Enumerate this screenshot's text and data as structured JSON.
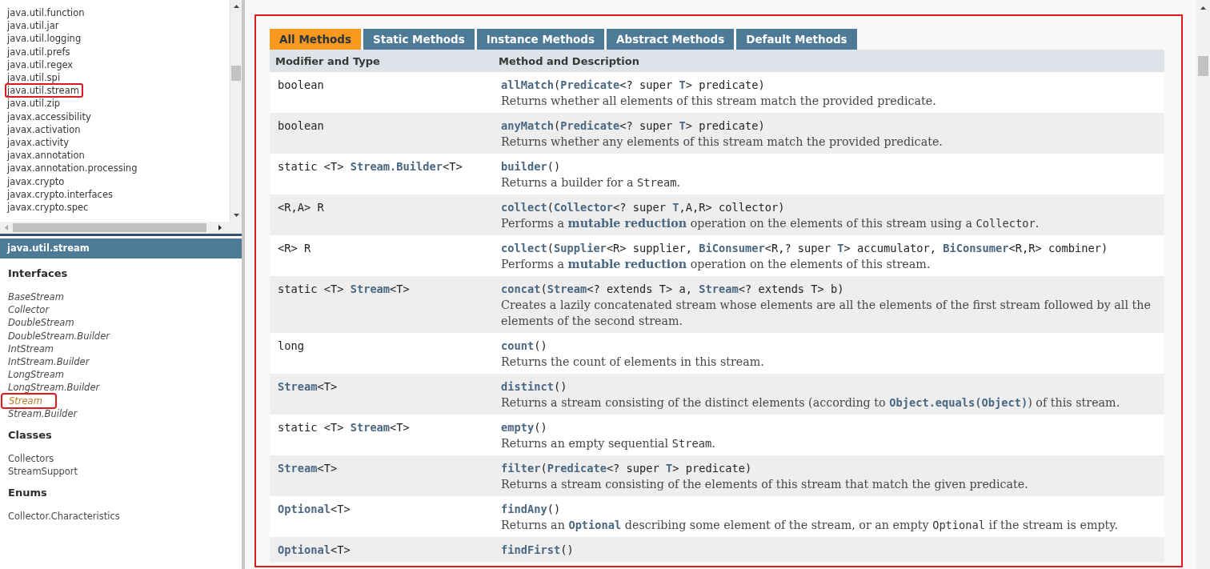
{
  "package_list": {
    "items": [
      {
        "label": "java.util.function",
        "highlighted": false
      },
      {
        "label": "java.util.jar",
        "highlighted": false
      },
      {
        "label": "java.util.logging",
        "highlighted": false
      },
      {
        "label": "java.util.prefs",
        "highlighted": false
      },
      {
        "label": "java.util.regex",
        "highlighted": false
      },
      {
        "label": "java.util.spi",
        "highlighted": false
      },
      {
        "label": "java.util.stream",
        "highlighted": true
      },
      {
        "label": "java.util.zip",
        "highlighted": false
      },
      {
        "label": "javax.accessibility",
        "highlighted": false
      },
      {
        "label": "javax.activation",
        "highlighted": false
      },
      {
        "label": "javax.activity",
        "highlighted": false
      },
      {
        "label": "javax.annotation",
        "highlighted": false
      },
      {
        "label": "javax.annotation.processing",
        "highlighted": false
      },
      {
        "label": "javax.crypto",
        "highlighted": false
      },
      {
        "label": "javax.crypto.interfaces",
        "highlighted": false
      },
      {
        "label": "javax.crypto.spec",
        "highlighted": false
      }
    ]
  },
  "package_frame": {
    "title": "java.util.stream",
    "sections": [
      {
        "heading": "Interfaces",
        "kind": "interface",
        "items": [
          {
            "label": "BaseStream",
            "current": false,
            "highlighted": false
          },
          {
            "label": "Collector",
            "current": false,
            "highlighted": false
          },
          {
            "label": "DoubleStream",
            "current": false,
            "highlighted": false
          },
          {
            "label": "DoubleStream.Builder",
            "current": false,
            "highlighted": false
          },
          {
            "label": "IntStream",
            "current": false,
            "highlighted": false
          },
          {
            "label": "IntStream.Builder",
            "current": false,
            "highlighted": false
          },
          {
            "label": "LongStream",
            "current": false,
            "highlighted": false
          },
          {
            "label": "LongStream.Builder",
            "current": false,
            "highlighted": false
          },
          {
            "label": "Stream",
            "current": true,
            "highlighted": true
          },
          {
            "label": "Stream.Builder",
            "current": false,
            "highlighted": false
          }
        ]
      },
      {
        "heading": "Classes",
        "kind": "class",
        "items": [
          {
            "label": "Collectors",
            "current": false,
            "highlighted": false
          },
          {
            "label": "StreamSupport",
            "current": false,
            "highlighted": false
          }
        ]
      },
      {
        "heading": "Enums",
        "kind": "class",
        "items": [
          {
            "label": "Collector.Characteristics",
            "current": false,
            "highlighted": false
          }
        ]
      }
    ]
  },
  "content": {
    "highlighted": true,
    "tabs": [
      {
        "label": "All Methods",
        "selected": true
      },
      {
        "label": "Static Methods",
        "selected": false
      },
      {
        "label": "Instance Methods",
        "selected": false
      },
      {
        "label": "Abstract Methods",
        "selected": false
      },
      {
        "label": "Default Methods",
        "selected": false
      }
    ],
    "columns": [
      "Modifier and Type",
      "Method and Description"
    ],
    "rows": [
      {
        "modifier": [
          {
            "text": "boolean",
            "kind": "plain"
          }
        ],
        "signature": [
          {
            "text": "allMatch",
            "kind": "link"
          },
          {
            "text": "(",
            "kind": "plain"
          },
          {
            "text": "Predicate",
            "kind": "link"
          },
          {
            "text": "<? super ",
            "kind": "plain"
          },
          {
            "text": "T",
            "kind": "link"
          },
          {
            "text": "> predicate)",
            "kind": "plain"
          }
        ],
        "description": [
          {
            "text": "Returns whether all elements of this stream match the provided predicate.",
            "kind": "plain"
          }
        ]
      },
      {
        "modifier": [
          {
            "text": "boolean",
            "kind": "plain"
          }
        ],
        "signature": [
          {
            "text": "anyMatch",
            "kind": "link"
          },
          {
            "text": "(",
            "kind": "plain"
          },
          {
            "text": "Predicate",
            "kind": "link"
          },
          {
            "text": "<? super ",
            "kind": "plain"
          },
          {
            "text": "T",
            "kind": "link"
          },
          {
            "text": "> predicate)",
            "kind": "plain"
          }
        ],
        "description": [
          {
            "text": "Returns whether any elements of this stream match the provided predicate.",
            "kind": "plain"
          }
        ]
      },
      {
        "modifier": [
          {
            "text": "static <T> ",
            "kind": "plain"
          },
          {
            "text": "Stream.Builder",
            "kind": "link"
          },
          {
            "text": "<T>",
            "kind": "plain"
          }
        ],
        "signature": [
          {
            "text": "builder",
            "kind": "link"
          },
          {
            "text": "()",
            "kind": "plain"
          }
        ],
        "description": [
          {
            "text": "Returns a builder for a ",
            "kind": "plain"
          },
          {
            "text": "Stream",
            "kind": "code"
          },
          {
            "text": ".",
            "kind": "plain"
          }
        ]
      },
      {
        "modifier": [
          {
            "text": "<R,A> R",
            "kind": "plain"
          }
        ],
        "signature": [
          {
            "text": "collect",
            "kind": "link"
          },
          {
            "text": "(",
            "kind": "plain"
          },
          {
            "text": "Collector",
            "kind": "link"
          },
          {
            "text": "<? super ",
            "kind": "plain"
          },
          {
            "text": "T",
            "kind": "link"
          },
          {
            "text": ",A,R> collector)",
            "kind": "plain"
          }
        ],
        "description": [
          {
            "text": "Performs a ",
            "kind": "plain"
          },
          {
            "text": "mutable reduction",
            "kind": "link"
          },
          {
            "text": " operation on the elements of this stream using a ",
            "kind": "plain"
          },
          {
            "text": "Collector",
            "kind": "code"
          },
          {
            "text": ".",
            "kind": "plain"
          }
        ]
      },
      {
        "modifier": [
          {
            "text": "<R> R",
            "kind": "plain"
          }
        ],
        "signature": [
          {
            "text": "collect",
            "kind": "link"
          },
          {
            "text": "(",
            "kind": "plain"
          },
          {
            "text": "Supplier",
            "kind": "link"
          },
          {
            "text": "<R> supplier, ",
            "kind": "plain"
          },
          {
            "text": "BiConsumer",
            "kind": "link"
          },
          {
            "text": "<R,? super ",
            "kind": "plain"
          },
          {
            "text": "T",
            "kind": "link"
          },
          {
            "text": "> accumulator, ",
            "kind": "plain"
          },
          {
            "text": "BiConsumer",
            "kind": "link"
          },
          {
            "text": "<R,R> combiner)",
            "kind": "plain"
          }
        ],
        "description": [
          {
            "text": "Performs a ",
            "kind": "plain"
          },
          {
            "text": "mutable reduction",
            "kind": "link"
          },
          {
            "text": " operation on the elements of this stream.",
            "kind": "plain"
          }
        ]
      },
      {
        "modifier": [
          {
            "text": "static <T> ",
            "kind": "plain"
          },
          {
            "text": "Stream",
            "kind": "link"
          },
          {
            "text": "<T>",
            "kind": "plain"
          }
        ],
        "signature": [
          {
            "text": "concat",
            "kind": "link"
          },
          {
            "text": "(",
            "kind": "plain"
          },
          {
            "text": "Stream",
            "kind": "link"
          },
          {
            "text": "<? extends T> a, ",
            "kind": "plain"
          },
          {
            "text": "Stream",
            "kind": "link"
          },
          {
            "text": "<? extends T> b)",
            "kind": "plain"
          }
        ],
        "description": [
          {
            "text": "Creates a lazily concatenated stream whose elements are all the elements of the first stream followed by all the elements of the second stream.",
            "kind": "plain"
          }
        ]
      },
      {
        "modifier": [
          {
            "text": "long",
            "kind": "plain"
          }
        ],
        "signature": [
          {
            "text": "count",
            "kind": "link"
          },
          {
            "text": "()",
            "kind": "plain"
          }
        ],
        "description": [
          {
            "text": "Returns the count of elements in this stream.",
            "kind": "plain"
          }
        ]
      },
      {
        "modifier": [
          {
            "text": "Stream",
            "kind": "link"
          },
          {
            "text": "<T>",
            "kind": "plain"
          }
        ],
        "signature": [
          {
            "text": "distinct",
            "kind": "link"
          },
          {
            "text": "()",
            "kind": "plain"
          }
        ],
        "description": [
          {
            "text": "Returns a stream consisting of the distinct elements (according to ",
            "kind": "plain"
          },
          {
            "text": "Object.equals(Object)",
            "kind": "codelink"
          },
          {
            "text": ") of this stream.",
            "kind": "plain"
          }
        ]
      },
      {
        "modifier": [
          {
            "text": "static <T> ",
            "kind": "plain"
          },
          {
            "text": "Stream",
            "kind": "link"
          },
          {
            "text": "<T>",
            "kind": "plain"
          }
        ],
        "signature": [
          {
            "text": "empty",
            "kind": "link"
          },
          {
            "text": "()",
            "kind": "plain"
          }
        ],
        "description": [
          {
            "text": "Returns an empty sequential ",
            "kind": "plain"
          },
          {
            "text": "Stream",
            "kind": "code"
          },
          {
            "text": ".",
            "kind": "plain"
          }
        ]
      },
      {
        "modifier": [
          {
            "text": "Stream",
            "kind": "link"
          },
          {
            "text": "<T>",
            "kind": "plain"
          }
        ],
        "signature": [
          {
            "text": "filter",
            "kind": "link"
          },
          {
            "text": "(",
            "kind": "plain"
          },
          {
            "text": "Predicate",
            "kind": "link"
          },
          {
            "text": "<? super ",
            "kind": "plain"
          },
          {
            "text": "T",
            "kind": "link"
          },
          {
            "text": "> predicate)",
            "kind": "plain"
          }
        ],
        "description": [
          {
            "text": "Returns a stream consisting of the elements of this stream that match the given predicate.",
            "kind": "plain"
          }
        ]
      },
      {
        "modifier": [
          {
            "text": "Optional",
            "kind": "link"
          },
          {
            "text": "<T>",
            "kind": "plain"
          }
        ],
        "signature": [
          {
            "text": "findAny",
            "kind": "link"
          },
          {
            "text": "()",
            "kind": "plain"
          }
        ],
        "description": [
          {
            "text": "Returns an ",
            "kind": "plain"
          },
          {
            "text": "Optional",
            "kind": "codelink"
          },
          {
            "text": " describing some element of the stream, or an empty ",
            "kind": "plain"
          },
          {
            "text": "Optional",
            "kind": "code"
          },
          {
            "text": " if the stream is empty.",
            "kind": "plain"
          }
        ]
      },
      {
        "modifier": [
          {
            "text": "Optional",
            "kind": "link"
          },
          {
            "text": "<T>",
            "kind": "plain"
          }
        ],
        "signature": [
          {
            "text": "findFirst",
            "kind": "link"
          },
          {
            "text": "()",
            "kind": "plain"
          }
        ]
      }
    ]
  }
}
